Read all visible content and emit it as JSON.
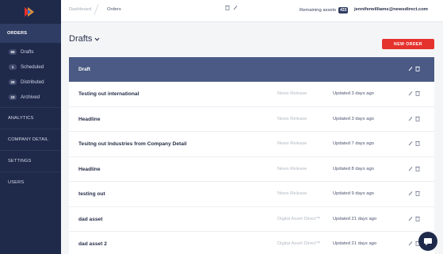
{
  "colors": {
    "sidebar": "#1f2a4b",
    "sidebar_active": "#2f3c63",
    "group_header": "#4a5a84",
    "accent": "#e5322d",
    "background": "#f4f5f7"
  },
  "sidebar": {
    "logo_icon": "newsdirect-logo",
    "sections": {
      "orders": "ORDERS",
      "analytics": "ANALYTICS",
      "company_detail": "COMPANY DETAIL",
      "settings": "SETTINGS",
      "users": "USERS"
    },
    "order_items": [
      {
        "count": "65",
        "label": "Drafts"
      },
      {
        "count": "1",
        "label": "Scheduled"
      },
      {
        "count": "26",
        "label": "Distributed"
      },
      {
        "count": "10",
        "label": "Archived"
      }
    ]
  },
  "topbar": {
    "breadcrumb": [
      "Dashboard",
      "Orders"
    ],
    "icons": [
      "trash-icon",
      "pencil-icon"
    ],
    "remaining_label": "Remaining assets",
    "remaining_count": "433",
    "user_email": "jenniferwilliams@newsdirect.com"
  },
  "main": {
    "title": "Drafts",
    "new_order_label": "NEW ORDER",
    "group_header": "Draft",
    "rows": [
      {
        "title": "Testing out international",
        "type": "News Release",
        "updated": "Updated 3 days ago"
      },
      {
        "title": "Headline",
        "type": "News Release",
        "updated": "Updated 3 days ago"
      },
      {
        "title": "Tesitng out Industries from Company Detail",
        "type": "News Release",
        "updated": "Updated 7 days ago"
      },
      {
        "title": "Headline",
        "type": "News Release",
        "updated": "Updated 8 days ago"
      },
      {
        "title": "testing out",
        "type": "News Release",
        "updated": "Updated 9 days ago"
      },
      {
        "title": "dad asset",
        "type": "Digital Asset Direct™",
        "updated": "Updated 21 days ago"
      },
      {
        "title": "dad asset 2",
        "type": "Digital Asset Direct™",
        "updated": "Updated 21 days ago"
      }
    ]
  },
  "chat_icon": "chat-bubble-icon"
}
